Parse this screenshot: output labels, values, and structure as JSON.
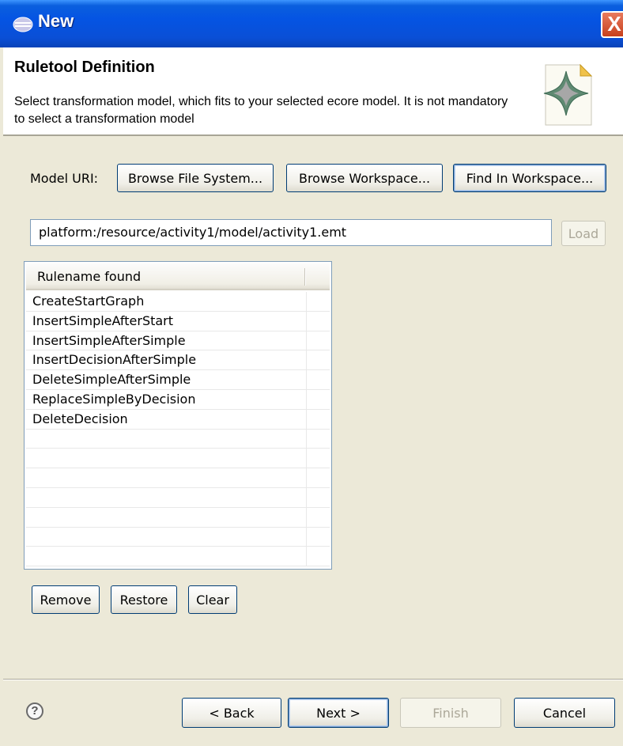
{
  "window": {
    "title": "New",
    "close_label": "X"
  },
  "banner": {
    "title": "Ruletool Definition",
    "description": "Select transformation model, which fits to your selected ecore model. It is not mandatory to select a transformation model"
  },
  "model": {
    "label": "Model URI:",
    "browse_fs": "Browse File System...",
    "browse_ws": "Browse Workspace...",
    "find_ws": "Find In Workspace...",
    "uri_value": "platform:/resource/activity1/model/activity1.emt",
    "load": "Load"
  },
  "table": {
    "header": "Rulename found",
    "rows": [
      "CreateStartGraph",
      "InsertSimpleAfterStart",
      "InsertSimpleAfterSimple",
      "InsertDecisionAfterSimple",
      "DeleteSimpleAfterSimple",
      "ReplaceSimpleByDecision",
      "DeleteDecision",
      "",
      "",
      "",
      "",
      "",
      "",
      ""
    ]
  },
  "actions": {
    "remove": "Remove",
    "restore": "Restore",
    "clear": "Clear"
  },
  "footer": {
    "help_icon": "?",
    "back": "< Back",
    "next": "Next >",
    "finish": "Finish",
    "cancel": "Cancel"
  },
  "colors": {
    "titlebar": "#0554e3",
    "dialog_bg": "#ece9d8",
    "close_button": "#c7401c"
  }
}
